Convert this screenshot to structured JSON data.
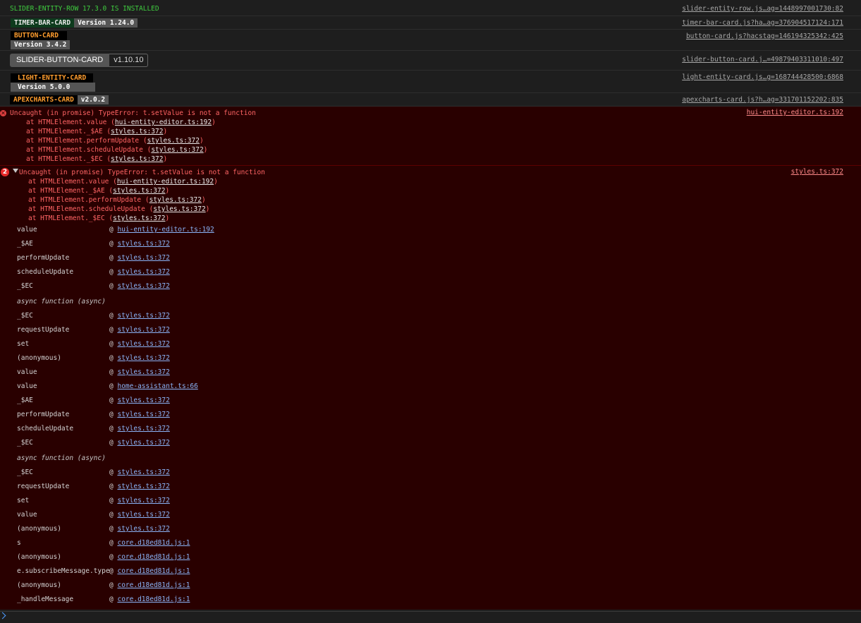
{
  "messages": [
    {
      "label": "SLIDER-ENTITY-ROW 17.3.0 IS INSTALLED",
      "source": "slider-entity-row.js…ag=1448997001730:82"
    },
    {
      "name": "TIMER-BAR-CARD",
      "version": "Version 1.24.0",
      "source": "timer-bar-card.js?ha…ag=376904517124:171"
    },
    {
      "name": "BUTTON-CARD",
      "version": "Version 3.4.2",
      "source": "button-card.js?hacstag=146194325342:425"
    },
    {
      "name": "SLIDER-BUTTON-CARD",
      "version": "v1.10.10",
      "source": "slider-button-card.j…=49879403311010:497"
    },
    {
      "name": "LIGHT-ENTITY-CARD",
      "version": "Version 5.0.0",
      "source": "light-entity-card.js…g=168744428500:6868"
    },
    {
      "name": "APEXCHARTS-CARD",
      "version": "v2.0.2",
      "source": "apexcharts-card.js?h…ag=331701152202:835"
    }
  ],
  "error1": {
    "source": "hui-entity-editor.ts:192",
    "message": "Uncaught (in promise) TypeError: t.setValue is not a function",
    "frames": [
      {
        "pre": "at HTMLElement.value (",
        "link": "hui-entity-editor.ts:192",
        "post": ")"
      },
      {
        "pre": "at HTMLElement._$AE (",
        "link": "styles.ts:372",
        "post": ")"
      },
      {
        "pre": "at HTMLElement.performUpdate (",
        "link": "styles.ts:372",
        "post": ")"
      },
      {
        "pre": "at HTMLElement.scheduleUpdate (",
        "link": "styles.ts:372",
        "post": ")"
      },
      {
        "pre": "at HTMLElement._$EC (",
        "link": "styles.ts:372",
        "post": ")"
      }
    ]
  },
  "error2": {
    "count": "2",
    "source": "styles.ts:372",
    "message": "Uncaught (in promise) TypeError: t.setValue is not a function",
    "frames": [
      {
        "pre": "at HTMLElement.value (",
        "link": "hui-entity-editor.ts:192",
        "post": ")"
      },
      {
        "pre": "at HTMLElement._$AE (",
        "link": "styles.ts:372",
        "post": ")"
      },
      {
        "pre": "at HTMLElement.performUpdate (",
        "link": "styles.ts:372",
        "post": ")"
      },
      {
        "pre": "at HTMLElement.scheduleUpdate (",
        "link": "styles.ts:372",
        "post": ")"
      },
      {
        "pre": "at HTMLElement._$EC (",
        "link": "styles.ts:372",
        "post": ")"
      }
    ]
  },
  "stack": [
    {
      "fn": "value",
      "at": "@",
      "link": "hui-entity-editor.ts:192"
    },
    {
      "fn": "_$AE",
      "at": "@",
      "link": "styles.ts:372"
    },
    {
      "fn": "performUpdate",
      "at": "@",
      "link": "styles.ts:372"
    },
    {
      "fn": "scheduleUpdate",
      "at": "@",
      "link": "styles.ts:372"
    },
    {
      "fn": "_$EC",
      "at": "@",
      "link": "styles.ts:372"
    },
    {
      "async": "async function (async)"
    },
    {
      "fn": "_$EC",
      "at": "@",
      "link": "styles.ts:372"
    },
    {
      "fn": "requestUpdate",
      "at": "@",
      "link": "styles.ts:372"
    },
    {
      "fn": "set",
      "at": "@",
      "link": "styles.ts:372"
    },
    {
      "fn": "(anonymous)",
      "at": "@",
      "link": "styles.ts:372"
    },
    {
      "fn": "value",
      "at": "@",
      "link": "styles.ts:372"
    },
    {
      "fn": "value",
      "at": "@",
      "link": "home-assistant.ts:66"
    },
    {
      "fn": "_$AE",
      "at": "@",
      "link": "styles.ts:372"
    },
    {
      "fn": "performUpdate",
      "at": "@",
      "link": "styles.ts:372"
    },
    {
      "fn": "scheduleUpdate",
      "at": "@",
      "link": "styles.ts:372"
    },
    {
      "fn": "_$EC",
      "at": "@",
      "link": "styles.ts:372"
    },
    {
      "async": "async function (async)"
    },
    {
      "fn": "_$EC",
      "at": "@",
      "link": "styles.ts:372"
    },
    {
      "fn": "requestUpdate",
      "at": "@",
      "link": "styles.ts:372"
    },
    {
      "fn": "set",
      "at": "@",
      "link": "styles.ts:372"
    },
    {
      "fn": "value",
      "at": "@",
      "link": "styles.ts:372"
    },
    {
      "fn": "(anonymous)",
      "at": "@",
      "link": "styles.ts:372"
    },
    {
      "fn": "s",
      "at": "@",
      "link": "core.d18ed81d.js:1"
    },
    {
      "fn": "(anonymous)",
      "at": "@",
      "link": "core.d18ed81d.js:1"
    },
    {
      "fn": "e.subscribeMessage.type",
      "at": "@",
      "link": "core.d18ed81d.js:1"
    },
    {
      "fn": "(anonymous)",
      "at": "@",
      "link": "core.d18ed81d.js:1"
    },
    {
      "fn": "_handleMessage",
      "at": "@",
      "link": "core.d18ed81d.js:1"
    }
  ],
  "icons": {
    "error": "error-x-icon",
    "caret": "expand-caret-icon",
    "prompt": "console-prompt-chevron-icon"
  },
  "colors": {
    "error_bg": "#290000",
    "error_text": "#ff6464",
    "link": "#8ab4f8",
    "green": "#3fcb3f",
    "orange": "#ff9d2e"
  }
}
